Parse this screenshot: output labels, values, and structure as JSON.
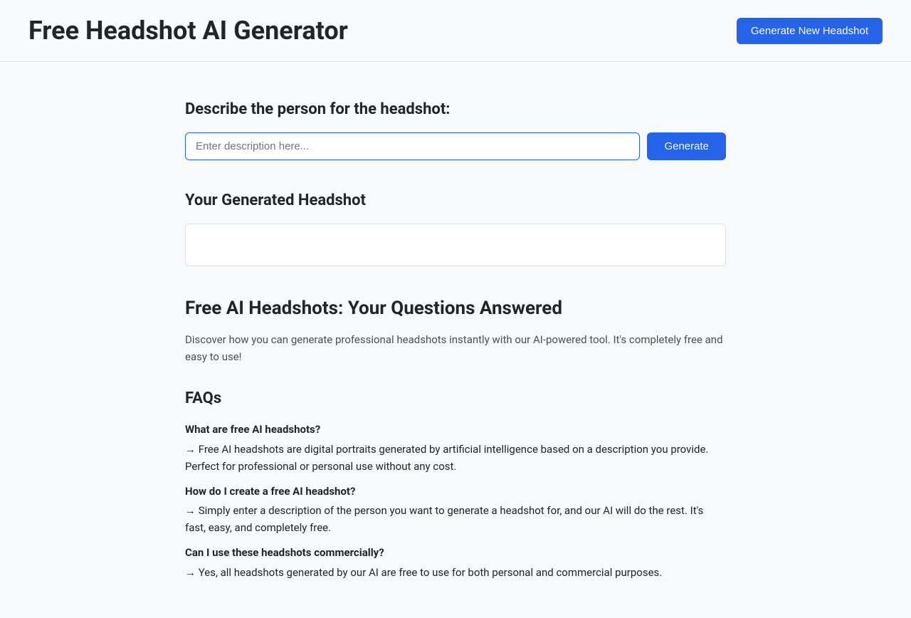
{
  "header": {
    "title": "Free Headshot AI Generator",
    "generate_new_label": "Generate New Headshot"
  },
  "main": {
    "describe_label": "Describe the person for the headshot:",
    "description_placeholder": "Enter description here...",
    "generate_label": "Generate",
    "generated_section_title": "Your Generated Headshot",
    "faq_intro": {
      "title": "Free AI Headshots: Your Questions Answered",
      "text": "Discover how you can generate professional headshots instantly with our AI-powered tool. It's completely free and easy to use!"
    },
    "faqs": {
      "title": "FAQs",
      "items": [
        {
          "question": "What are free AI headshots?",
          "answer": "→  Free AI headshots are digital portraits generated by artificial intelligence based on a description you provide. Perfect for professional or personal use without any cost."
        },
        {
          "question": "How do I create a free AI headshot?",
          "answer": "→  Simply enter a description of the person you want to generate a headshot for, and our AI will do the rest. It's fast, easy, and completely free."
        },
        {
          "question": "Can I use these headshots commercially?",
          "answer": "→  Yes, all headshots generated by our AI are free to use for both personal and commercial purposes."
        }
      ]
    }
  }
}
